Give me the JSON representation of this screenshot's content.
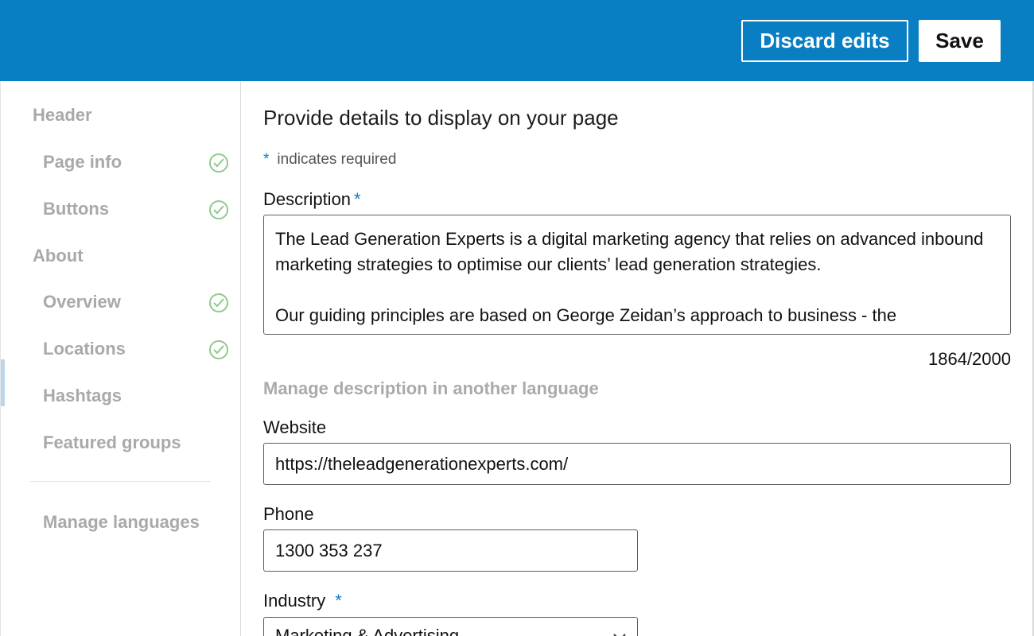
{
  "toolbar": {
    "discard_label": "Discard edits",
    "save_label": "Save"
  },
  "sidebar": {
    "groups": [
      {
        "label": "Header",
        "items": [
          {
            "label": "Page info",
            "complete": true
          },
          {
            "label": "Buttons",
            "complete": true
          }
        ]
      },
      {
        "label": "About",
        "items": [
          {
            "label": "Overview",
            "complete": true,
            "selected": true
          },
          {
            "label": "Locations",
            "complete": true
          },
          {
            "label": "Hashtags",
            "complete": false
          },
          {
            "label": "Featured groups",
            "complete": false
          }
        ]
      }
    ],
    "manage_languages": "Manage languages"
  },
  "form": {
    "heading": "Provide details to display on your page",
    "required_star": "*",
    "required_note": "indicates required",
    "description": {
      "label": "Description",
      "paragraph1": "The Lead Generation Experts is a digital marketing agency that relies on advanced inbound marketing strategies to optimise our clients’ lead generation strategies.",
      "paragraph2": "Our guiding principles are based on George Zeidan’s approach to business - the",
      "counter": "1864/2000"
    },
    "manage_language_link": "Manage description in another language",
    "website": {
      "label": "Website",
      "value": "https://theleadgenerationexperts.com/"
    },
    "phone": {
      "label": "Phone",
      "value": "1300 353 237"
    },
    "industry": {
      "label": "Industry",
      "value": "Marketing & Advertising"
    }
  },
  "colors": {
    "topbar": "#0a7ec2",
    "check": "#8fc98c",
    "muted_text": "#a9a9a9"
  },
  "icons": {
    "complete": "check-circle-icon",
    "dropdown": "chevron-down-icon"
  }
}
